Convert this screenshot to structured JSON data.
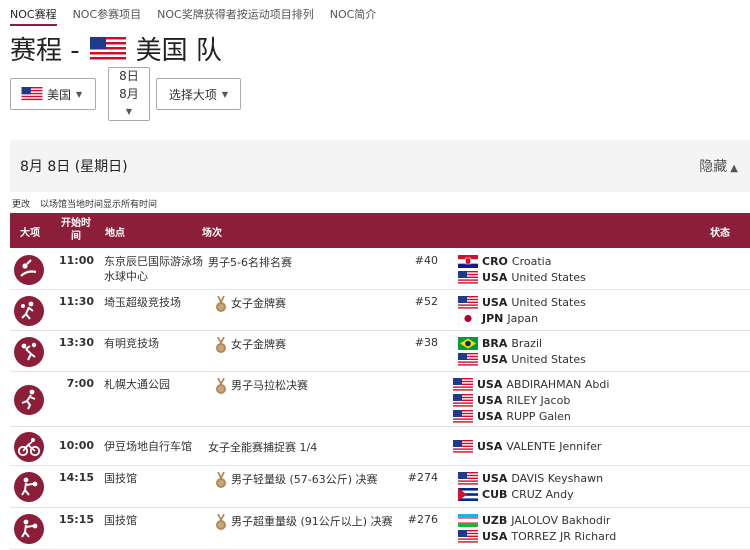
{
  "tabs": [
    "NOC赛程",
    "NOC参赛项目",
    "NOC奖牌获得者按运动项目排列",
    "NOC简介"
  ],
  "page": {
    "title_prefix": "赛程 -",
    "team": "美国 队"
  },
  "filters": {
    "country": "美国",
    "date_day": "8日",
    "date_month": "8月",
    "sport_placeholder": "选择大项"
  },
  "day": {
    "title": "8月 8日 (星期日)",
    "hide": "隐藏"
  },
  "note": {
    "update": "更改",
    "text": "以场馆当地时间显示所有时间"
  },
  "columns": {
    "sport": "大项",
    "time": "开始时间",
    "venue": "地点",
    "event": "场次",
    "status": "状态"
  },
  "icons": {
    "sport": "sport-pictogram-icon",
    "medal": "bronze-medal-icon",
    "caret": "caret-down-icon",
    "chevron": "chevron-up-icon"
  },
  "colors": {
    "accent": "#8b1f3a",
    "medal": "#b08a5c"
  },
  "rows": [
    {
      "sport": "water-polo",
      "time": "11:00",
      "venue": "东京辰巳国际游泳场水球中心",
      "medal": false,
      "event": "男子5-6名排名赛",
      "num": "#40",
      "competitors": [
        {
          "flag": "CRO",
          "code": "CRO",
          "name": "Croatia"
        },
        {
          "flag": "USA",
          "code": "USA",
          "name": "United States"
        }
      ]
    },
    {
      "sport": "basketball",
      "time": "11:30",
      "venue": "埼玉超级竞技场",
      "medal": true,
      "event": "女子金牌赛",
      "num": "#52",
      "competitors": [
        {
          "flag": "USA",
          "code": "USA",
          "name": "United States"
        },
        {
          "flag": "JPN",
          "code": "JPN",
          "name": "Japan"
        }
      ]
    },
    {
      "sport": "volleyball",
      "time": "13:30",
      "venue": "有明竞技场",
      "medal": true,
      "event": "女子金牌赛",
      "num": "#38",
      "competitors": [
        {
          "flag": "BRA",
          "code": "BRA",
          "name": "Brazil"
        },
        {
          "flag": "USA",
          "code": "USA",
          "name": "United States"
        }
      ]
    },
    {
      "sport": "marathon",
      "time": "7:00",
      "venue": "札幌大通公园",
      "medal": true,
      "event": "男子马拉松决赛",
      "num": "",
      "competitors": [
        {
          "flag": "USA",
          "code": "USA",
          "name": "ABDIRAHMAN Abdi"
        },
        {
          "flag": "USA",
          "code": "USA",
          "name": "RILEY Jacob"
        },
        {
          "flag": "USA",
          "code": "USA",
          "name": "RUPP Galen"
        }
      ]
    },
    {
      "sport": "cycling-track",
      "time": "10:00",
      "venue": "伊豆场地自行车馆",
      "medal": false,
      "event": "女子全能赛捕捉赛 1/4",
      "num": "",
      "competitors": [
        {
          "flag": "USA",
          "code": "USA",
          "name": "VALENTE Jennifer"
        }
      ]
    },
    {
      "sport": "boxing",
      "time": "14:15",
      "venue": "国技馆",
      "medal": true,
      "event": "男子轻量级 (57-63公斤) 决赛",
      "num": "#274",
      "competitors": [
        {
          "flag": "USA",
          "code": "USA",
          "name": "DAVIS Keyshawn"
        },
        {
          "flag": "CUB",
          "code": "CUB",
          "name": "CRUZ Andy"
        }
      ]
    },
    {
      "sport": "boxing",
      "time": "15:15",
      "venue": "国技馆",
      "medal": true,
      "event": "男子超重量级 (91公斤以上) 决赛",
      "num": "#276",
      "competitors": [
        {
          "flag": "UZB",
          "code": "UZB",
          "name": "JALOLOV Bakhodir"
        },
        {
          "flag": "USA",
          "code": "USA",
          "name": "TORREZ JR Richard"
        }
      ]
    }
  ]
}
